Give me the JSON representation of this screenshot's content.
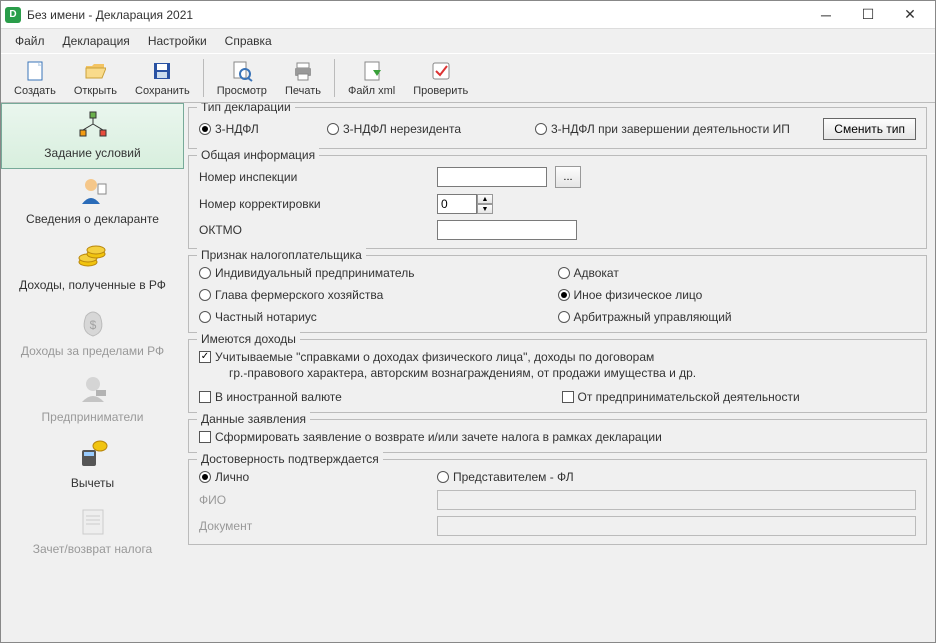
{
  "window": {
    "title": "Без имени - Декларация 2021"
  },
  "menu": {
    "file": "Файл",
    "decl": "Декларация",
    "settings": "Настройки",
    "help": "Справка"
  },
  "toolbar": {
    "create": "Создать",
    "open": "Открыть",
    "save": "Сохранить",
    "preview": "Просмотр",
    "print": "Печать",
    "xml": "Файл xml",
    "check": "Проверить"
  },
  "sidebar": {
    "conditions": "Задание условий",
    "declarant": "Сведения о декларанте",
    "income_rf": "Доходы, полученные в РФ",
    "income_abroad": "Доходы за пределами РФ",
    "entrepreneurs": "Предприниматели",
    "deductions": "Вычеты",
    "refund": "Зачет/возврат налога"
  },
  "type": {
    "legend": "Тип декларации",
    "opt1": "3-НДФЛ",
    "opt2": "3-НДФЛ нерезидента",
    "opt3": "3-НДФЛ при завершении деятельности ИП",
    "change": "Сменить тип"
  },
  "general": {
    "legend": "Общая информация",
    "inspection": "Номер инспекции",
    "inspection_value": "",
    "browse": "...",
    "correction": "Номер корректировки",
    "correction_value": "0",
    "oktmo": "ОКТМО",
    "oktmo_value": ""
  },
  "taxpayer": {
    "legend": "Признак налогоплательщика",
    "ip": "Индивидуальный предприниматель",
    "farmer": "Глава фермерского хозяйства",
    "notary": "Частный нотариус",
    "lawyer": "Адвокат",
    "other": "Иное физическое лицо",
    "arbitr": "Арбитражный управляющий"
  },
  "income": {
    "legend": "Имеются доходы",
    "cert": "Учитываемые \"справками о доходах физического лица\", доходы по договорам",
    "cert2": "гр.-правового характера, авторским вознаграждениям, от продажи имущества и др.",
    "foreign": "В иностранной валюте",
    "business": "От предпринимательской деятельности"
  },
  "statement": {
    "legend": "Данные заявления",
    "form": "Сформировать заявление о  возврате и/или зачете налога в рамках декларации"
  },
  "reliability": {
    "legend": "Достоверность подтверждается",
    "self": "Лично",
    "repr": "Представителем - ФЛ",
    "fio": "ФИО",
    "doc": "Документ"
  }
}
